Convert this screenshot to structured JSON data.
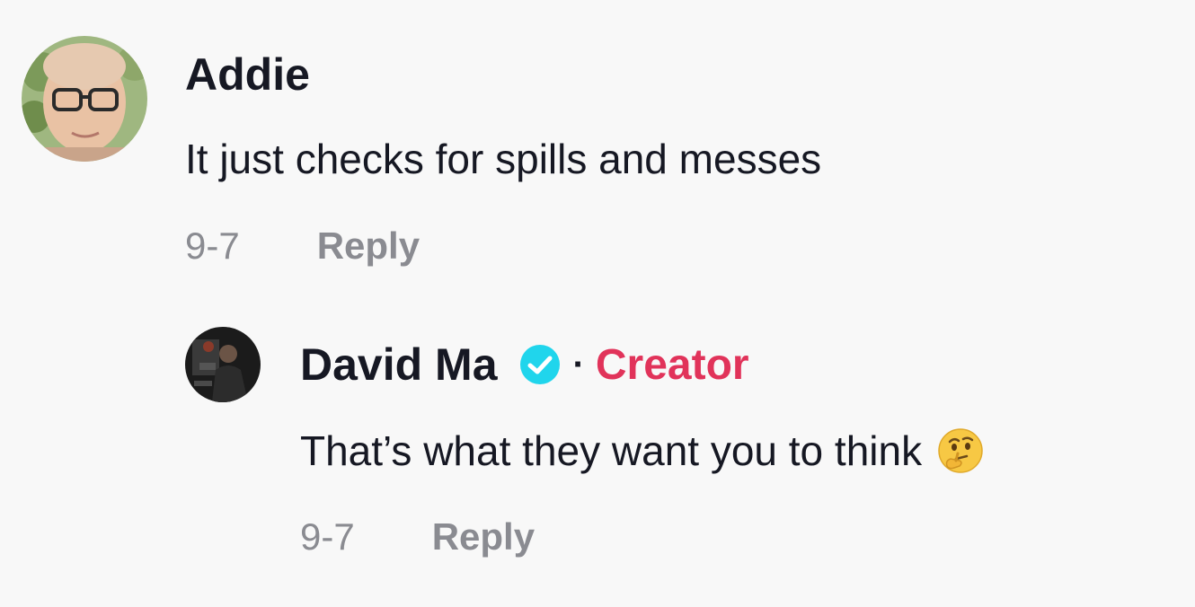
{
  "comments": [
    {
      "username": "Addie",
      "text": "It just checks for spills and messes",
      "date": "9-7",
      "reply_label": "Reply"
    }
  ],
  "replies": [
    {
      "username": "David Ma",
      "verified": true,
      "separator": "·",
      "role_badge": "Creator",
      "text": "That’s what they want you to think",
      "emoji": "thinking-face",
      "date": "9-7",
      "reply_label": "Reply"
    }
  ],
  "colors": {
    "background": "#f8f8f8",
    "text_primary": "#161823",
    "text_secondary": "#8a8b91",
    "creator_accent": "#e1335a",
    "verified_badge": "#20d5ec"
  },
  "icons": [
    "user-avatar-addie",
    "user-avatar-david-ma",
    "verified-badge-icon",
    "thinking-face-emoji"
  ]
}
